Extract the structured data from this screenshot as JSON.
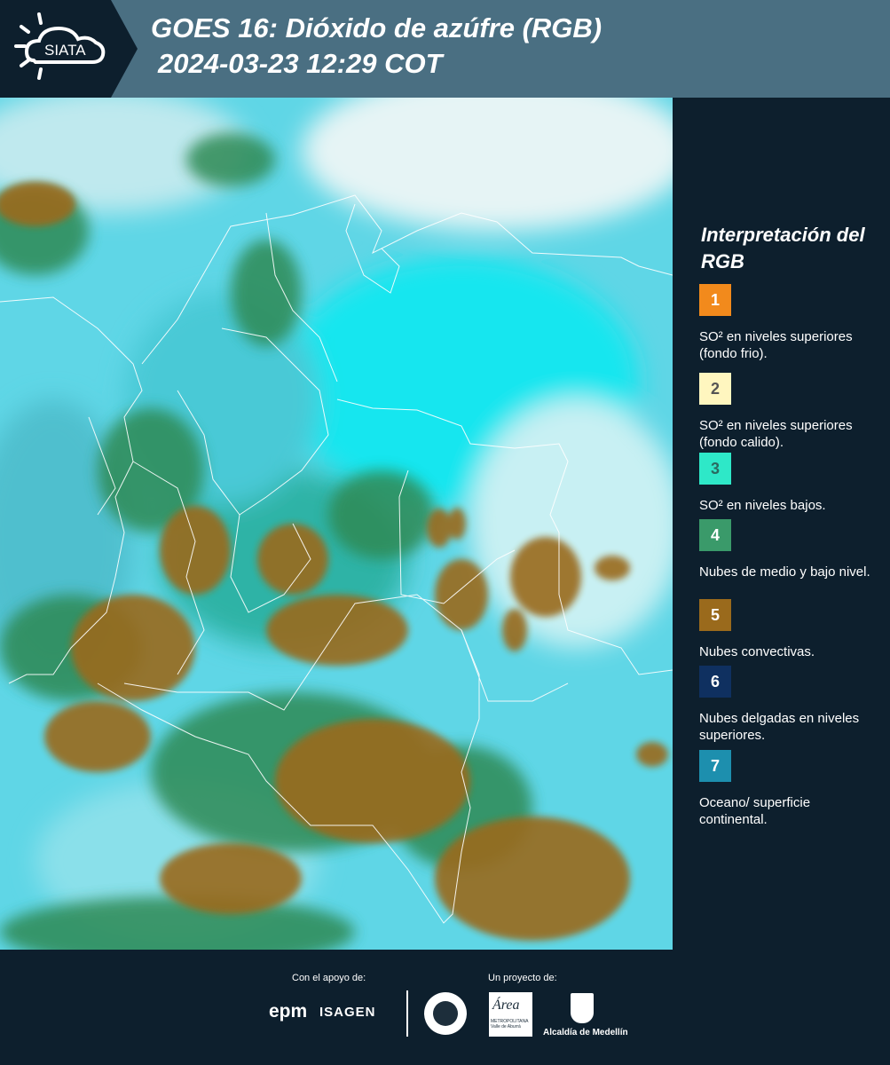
{
  "header": {
    "logo_text": "SIATA",
    "title": "GOES 16: Dióxido de azúfre (RGB)",
    "timestamp": "2024-03-23 12:29 COT",
    "background": "#4a6f82",
    "logo_background": "#0d1f2d"
  },
  "legend": {
    "title": "Interpretación del RGB",
    "items": [
      {
        "number": "1",
        "label": "SO² en niveles superiores (fondo frio).",
        "color": "#f28a1c"
      },
      {
        "number": "2",
        "label": "SO² en niveles superiores (fondo calido).",
        "color": "#fff6bf"
      },
      {
        "number": "3",
        "label": "SO² en niveles bajos.",
        "color": "#2ee8c8"
      },
      {
        "number": "4",
        "label": "Nubes de medio y bajo nivel.",
        "color": "#3a9a6a"
      },
      {
        "number": "5",
        "label": "Nubes convectivas.",
        "color": "#9a6a1c"
      },
      {
        "number": "6",
        "label": "Nubes delgadas en niveles superiores.",
        "color": "#0f3060"
      },
      {
        "number": "7",
        "label": "Oceano/ superficie continental.",
        "color": "#1d8fae"
      }
    ]
  },
  "footer": {
    "support_label": "Con el apoyo de:",
    "project_label": "Un proyecto de:",
    "partners": [
      "epm",
      "ISAGEN"
    ],
    "area_logo_word": "Área",
    "area_logo_sub": "METROPOLITANA Valle de Aburrá",
    "alcaldia": "Alcaldía de Medellín"
  }
}
